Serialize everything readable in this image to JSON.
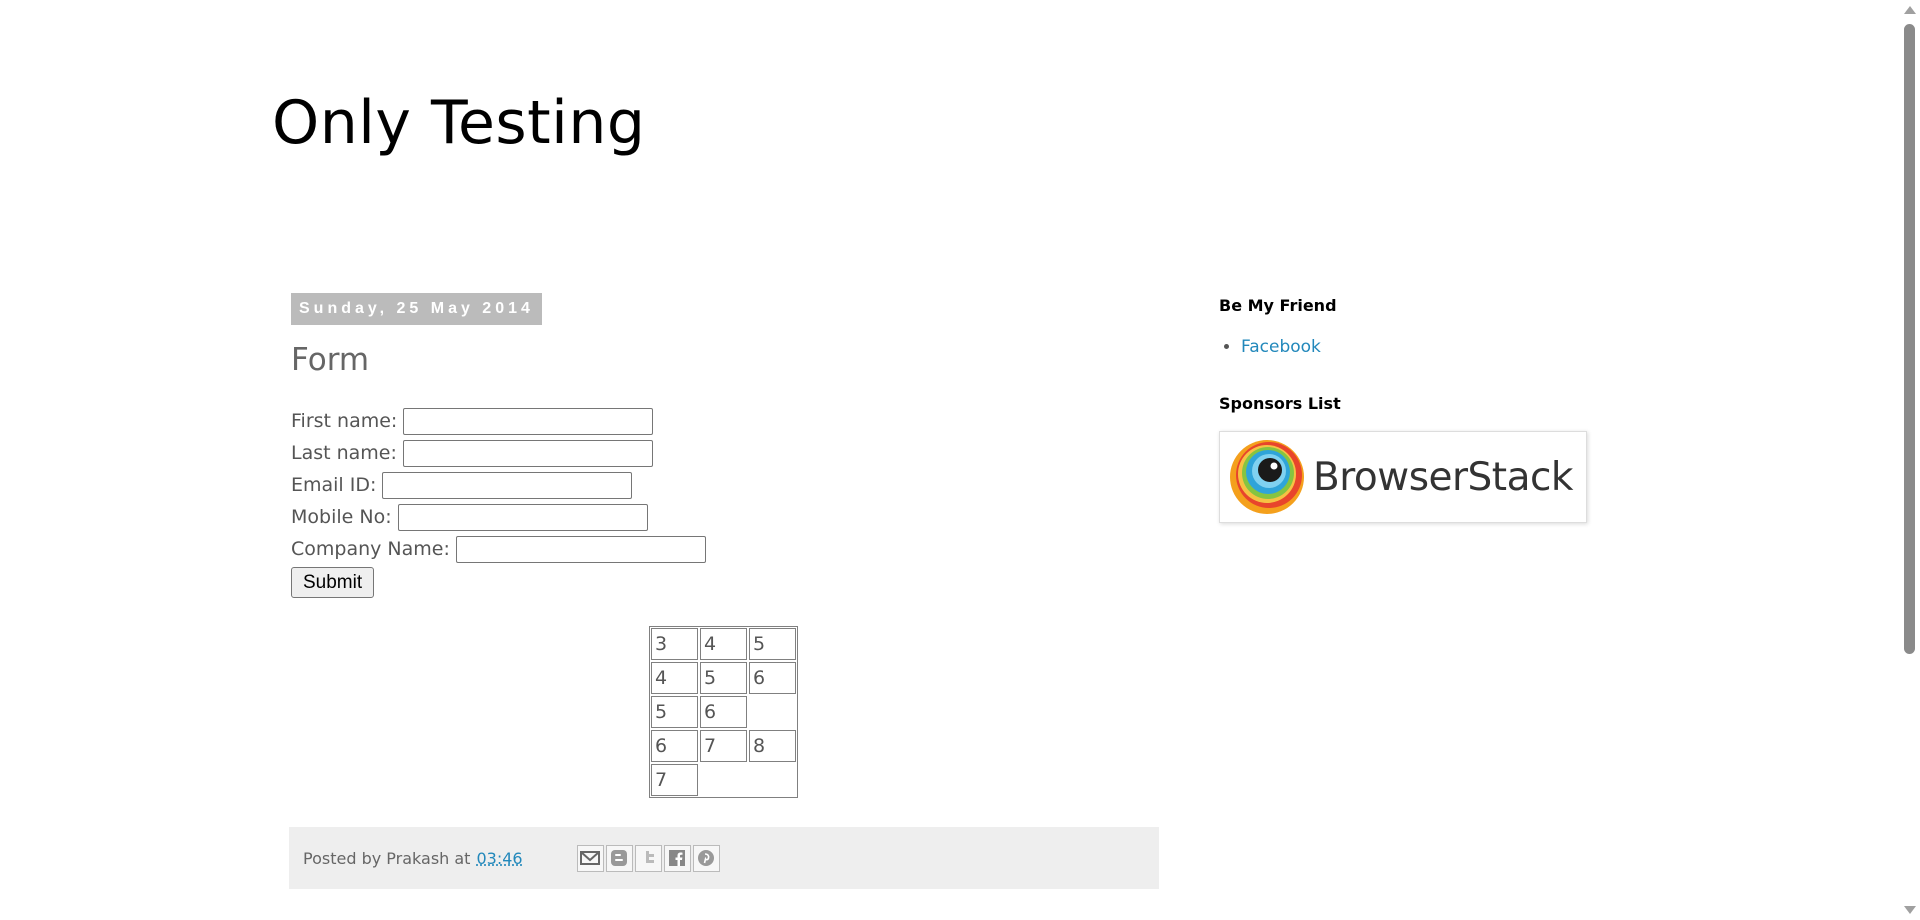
{
  "blog": {
    "title": "Only Testing"
  },
  "post": {
    "date": "Sunday, 25 May 2014",
    "title": "Form",
    "form": {
      "first_name_label": "First name:",
      "last_name_label": "Last name:",
      "email_label": "Email ID:",
      "mobile_label": "Mobile No:",
      "company_label": "Company Name:",
      "first_name_value": "",
      "last_name_value": "",
      "email_value": "",
      "mobile_value": "",
      "company_value": "",
      "submit_label": "Submit"
    },
    "table": {
      "rows": [
        [
          "3",
          "4",
          "5"
        ],
        [
          "4",
          "5",
          "6"
        ],
        [
          "5",
          "6",
          ""
        ],
        [
          "6",
          "7",
          "8"
        ],
        [
          "7",
          "",
          ""
        ]
      ]
    },
    "footer": {
      "posted_by": "Posted by Prakash at",
      "time": "03:46",
      "share_icons": [
        "email-icon",
        "blogger-icon",
        "twitter-icon",
        "facebook-icon",
        "pinterest-icon"
      ]
    }
  },
  "sidebar": {
    "widget1_title": "Be My Friend",
    "links": [
      "Facebook"
    ],
    "widget2_title": "Sponsors List",
    "sponsor_name": "BrowserStack"
  },
  "colors": {
    "link": "#2288bb",
    "date_bg": "#bbbbbb",
    "footer_bg": "#eeeeee"
  }
}
